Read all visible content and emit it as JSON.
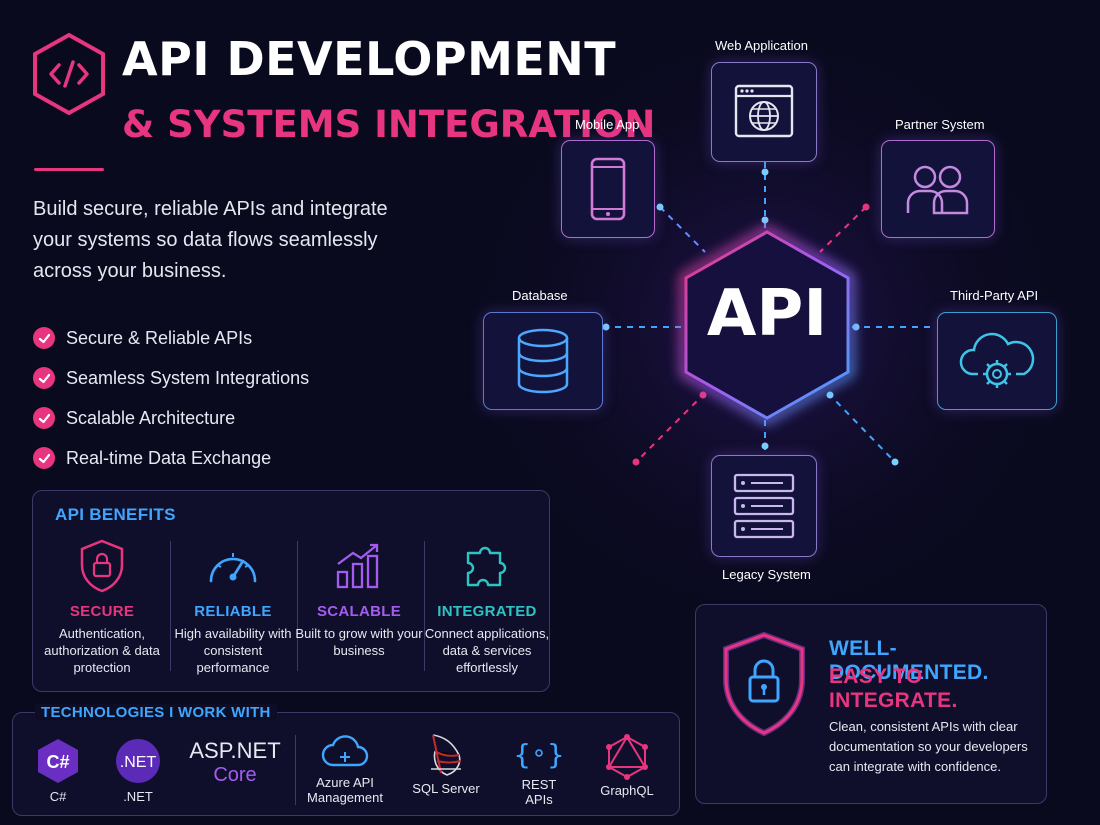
{
  "header": {
    "title_line1": "API DEVELOPMENT",
    "title_line2": "& SYSTEMS INTEGRATION",
    "logo_icon": "code-brackets-icon"
  },
  "intro": "Build secure, reliable APIs and integrate your systems so data flows seamlessly across your business.",
  "features": [
    "Secure & Reliable APIs",
    "Seamless System Integrations",
    "Scalable Architecture",
    "Real-time Data Exchange"
  ],
  "benefits": {
    "title": "API BENEFITS",
    "items": [
      {
        "title": "SECURE",
        "desc": "Authentication, authorization & data protection",
        "icon": "shield-lock-icon",
        "color": "#e8357f"
      },
      {
        "title": "RELIABLE",
        "desc": "High availability with consistent performance",
        "icon": "speedometer-icon",
        "color": "#3ea6ff"
      },
      {
        "title": "SCALABLE",
        "desc": "Built to grow with your business",
        "icon": "growth-chart-icon",
        "color": "#a45cf0"
      },
      {
        "title": "INTEGRATED",
        "desc": "Connect applications, data & services effortlessly",
        "icon": "puzzle-icon",
        "color": "#2ec4c4"
      }
    ]
  },
  "technologies": {
    "title": "TECHNOLOGIES I WORK WITH",
    "items": [
      {
        "label": "C#",
        "badge": "C#",
        "icon": "csharp-icon"
      },
      {
        "label": ".NET",
        "badge": ".NET",
        "icon": "dotnet-icon"
      },
      {
        "label": "",
        "badge_line1": "ASP.NET",
        "badge_line2": "Core",
        "icon": "aspnet-core-icon"
      },
      {
        "label": "Azure API Management",
        "icon": "cloud-icon"
      },
      {
        "label": "SQL Server",
        "icon": "sql-server-icon"
      },
      {
        "label": "REST APIs",
        "badge": "{ }",
        "icon": "rest-api-icon"
      },
      {
        "label": "GraphQL",
        "icon": "graphql-icon"
      }
    ]
  },
  "diagram": {
    "center": "API",
    "nodes": {
      "web_application": "Web Application",
      "mobile_app": "Mobile App",
      "partner_system": "Partner System",
      "database": "Database",
      "third_party_api": "Third-Party API",
      "legacy_system": "Legacy System"
    }
  },
  "doc_card": {
    "heading_line1": "WELL-DOCUMENTED.",
    "heading_line2": "EASY TO INTEGRATE.",
    "body": "Clean, consistent APIs with clear documentation so your developers can integrate with confidence."
  },
  "colors": {
    "background": "#0a0a1f",
    "pink": "#e8357f",
    "blue": "#3ea6ff",
    "purple": "#a45cf0",
    "teal": "#2ec4c4"
  }
}
